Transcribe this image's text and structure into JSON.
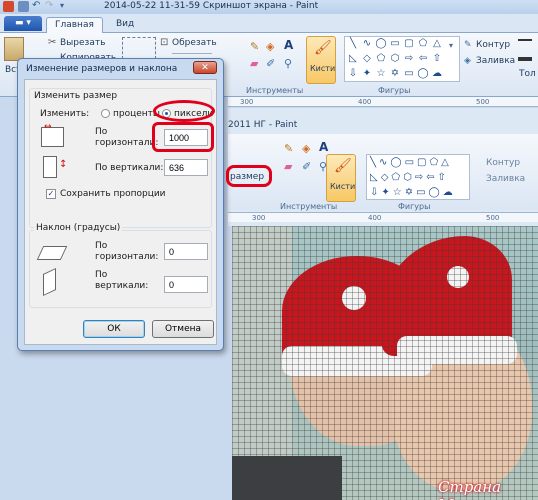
{
  "titlebar": {
    "title": "2014-05-22 11-31-59 Скриншот экрана - Paint"
  },
  "tabs": {
    "home": "Главная",
    "view": "Вид"
  },
  "ribbon": {
    "paste": "Вста",
    "cut": "Вырезать",
    "copy": "Копировать",
    "crop": "Обрезать",
    "tools_group": "Инструменты",
    "brushes": "Кисти",
    "shapes_group": "Фигуры",
    "outline": "Контур",
    "fill": "Заливка",
    "thickness": "Тол"
  },
  "background": {
    "window_title_fragment": "2011 НГ - Paint",
    "resize_fragment": "размер",
    "tools_group": "Инструменты",
    "brushes": "Кисти",
    "shapes_group": "Фигуры",
    "outline": "Контур",
    "fill": "Заливка",
    "ruler": [
      "300",
      "400",
      "500"
    ],
    "inner_ruler": [
      "300",
      "400",
      "500"
    ]
  },
  "dialog": {
    "title": "Изменение размеров и наклона",
    "resize_group": "Изменить размер",
    "by_label": "Изменить:",
    "percent": "проценты",
    "pixels": "пиксели",
    "horizontal_label_1": "По",
    "horizontal_label_2": "горизонтали:",
    "horizontal_value": "1000",
    "vertical_label": "По вертикали:",
    "vertical_value": "636",
    "keep_ratio": "Сохранить пропорции",
    "skew_group": "Наклон (градусы)",
    "skew_h_label_1": "По",
    "skew_h_label_2": "горизонтали:",
    "skew_h_value": "0",
    "skew_v_label_1": "По",
    "skew_v_label_2": "вертикали:",
    "skew_v_value": "0",
    "ok": "ОК",
    "cancel": "Отмена",
    "close": "✕"
  },
  "watermark": "Страна Мам",
  "colors": {
    "highlight": "#e0001b",
    "hat": "#c8161f",
    "accent": "#1f56ad"
  }
}
